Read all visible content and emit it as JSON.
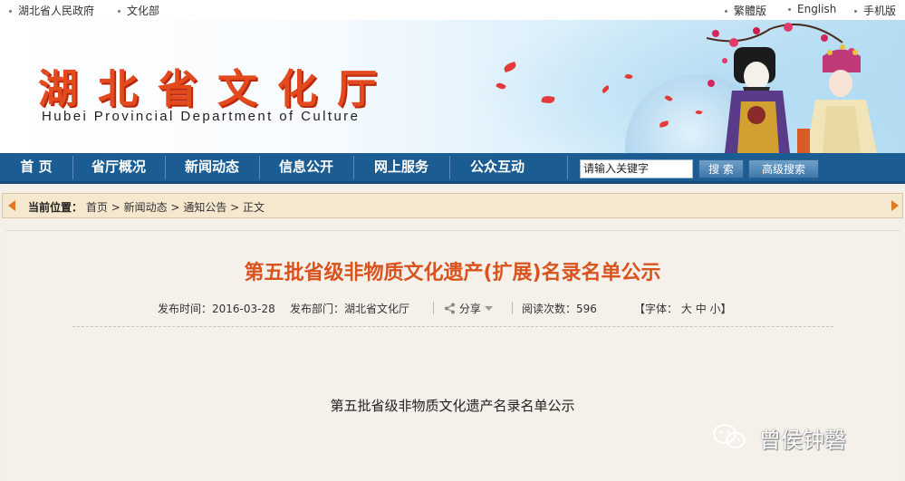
{
  "topbar": {
    "left_links": [
      "湖北省人民政府",
      "文化部"
    ],
    "right_links": [
      "繁體版",
      "English",
      "手机版"
    ]
  },
  "banner": {
    "title_cn": "湖北省文化厅",
    "title_en": "Hubei Provincial Department of Culture"
  },
  "nav": {
    "items": [
      "首 页",
      "省厅概况",
      "新闻动态",
      "信息公开",
      "网上服务",
      "公众互动"
    ],
    "search_value": "请输入关键字",
    "search_button": "搜 索",
    "advanced_button": "高级搜索"
  },
  "breadcrumb": {
    "label": "当前位置：",
    "items": [
      "首页",
      "新闻动态",
      "通知公告",
      "正文"
    ],
    "separator": ">"
  },
  "article": {
    "title": "第五批省级非物质文化遗产(扩展)名录名单公示",
    "publish_time_label": "发布时间：",
    "publish_time": "2016-03-28",
    "department_label": "发布部门：",
    "department": "湖北省文化厅",
    "share_label": "分享",
    "read_label": "阅读次数：",
    "read_count": "596",
    "font_label": "【字体：",
    "font_sizes": [
      "大",
      "中",
      "小"
    ],
    "font_close": "】",
    "body_line": "第五批省级非物质文化遗产名录名单公示"
  },
  "watermark": {
    "text": "曾侯钟磬"
  },
  "colors": {
    "nav_bg": "#1b5c92",
    "title_orange": "#d9531e",
    "logo_red": "#e34a1d",
    "crumb_bg": "#f6e7cf"
  }
}
